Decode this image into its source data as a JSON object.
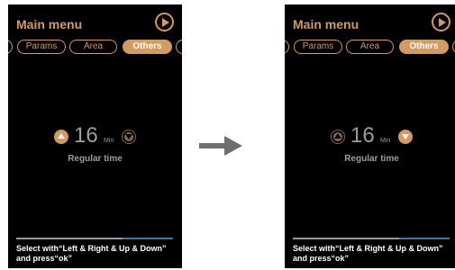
{
  "screens": [
    {
      "title": "Main menu",
      "tabs": [
        "Params",
        "Area",
        "Others"
      ],
      "active_tab": "Others",
      "value": "16",
      "unit": "Min",
      "label": "Regular time",
      "highlighted_button": "increase",
      "hint": "Select with“Left & Right & Up & Down” and press“ok”"
    },
    {
      "title": "Main menu",
      "tabs": [
        "Params",
        "Area",
        "Others"
      ],
      "active_tab": "Others",
      "value": "16",
      "unit": "Min",
      "label": "Regular time",
      "highlighted_button": "decrease",
      "hint": "Select with“Left & Right & Up & Down” and press“ok”"
    }
  ],
  "colors": {
    "accent": "#d39a62",
    "screen_bg": "#000000",
    "value_text": "#9d9d9d",
    "hint_text": "#ffffff",
    "flow_arrow": "#6e6e6e",
    "progress_accent": "#3f74a6"
  },
  "icons": {
    "play": "play-circle-icon",
    "increase": "triangle-up-circle-icon",
    "decrease": "triangle-down-circle-icon",
    "flow": "right-arrow-icon"
  }
}
